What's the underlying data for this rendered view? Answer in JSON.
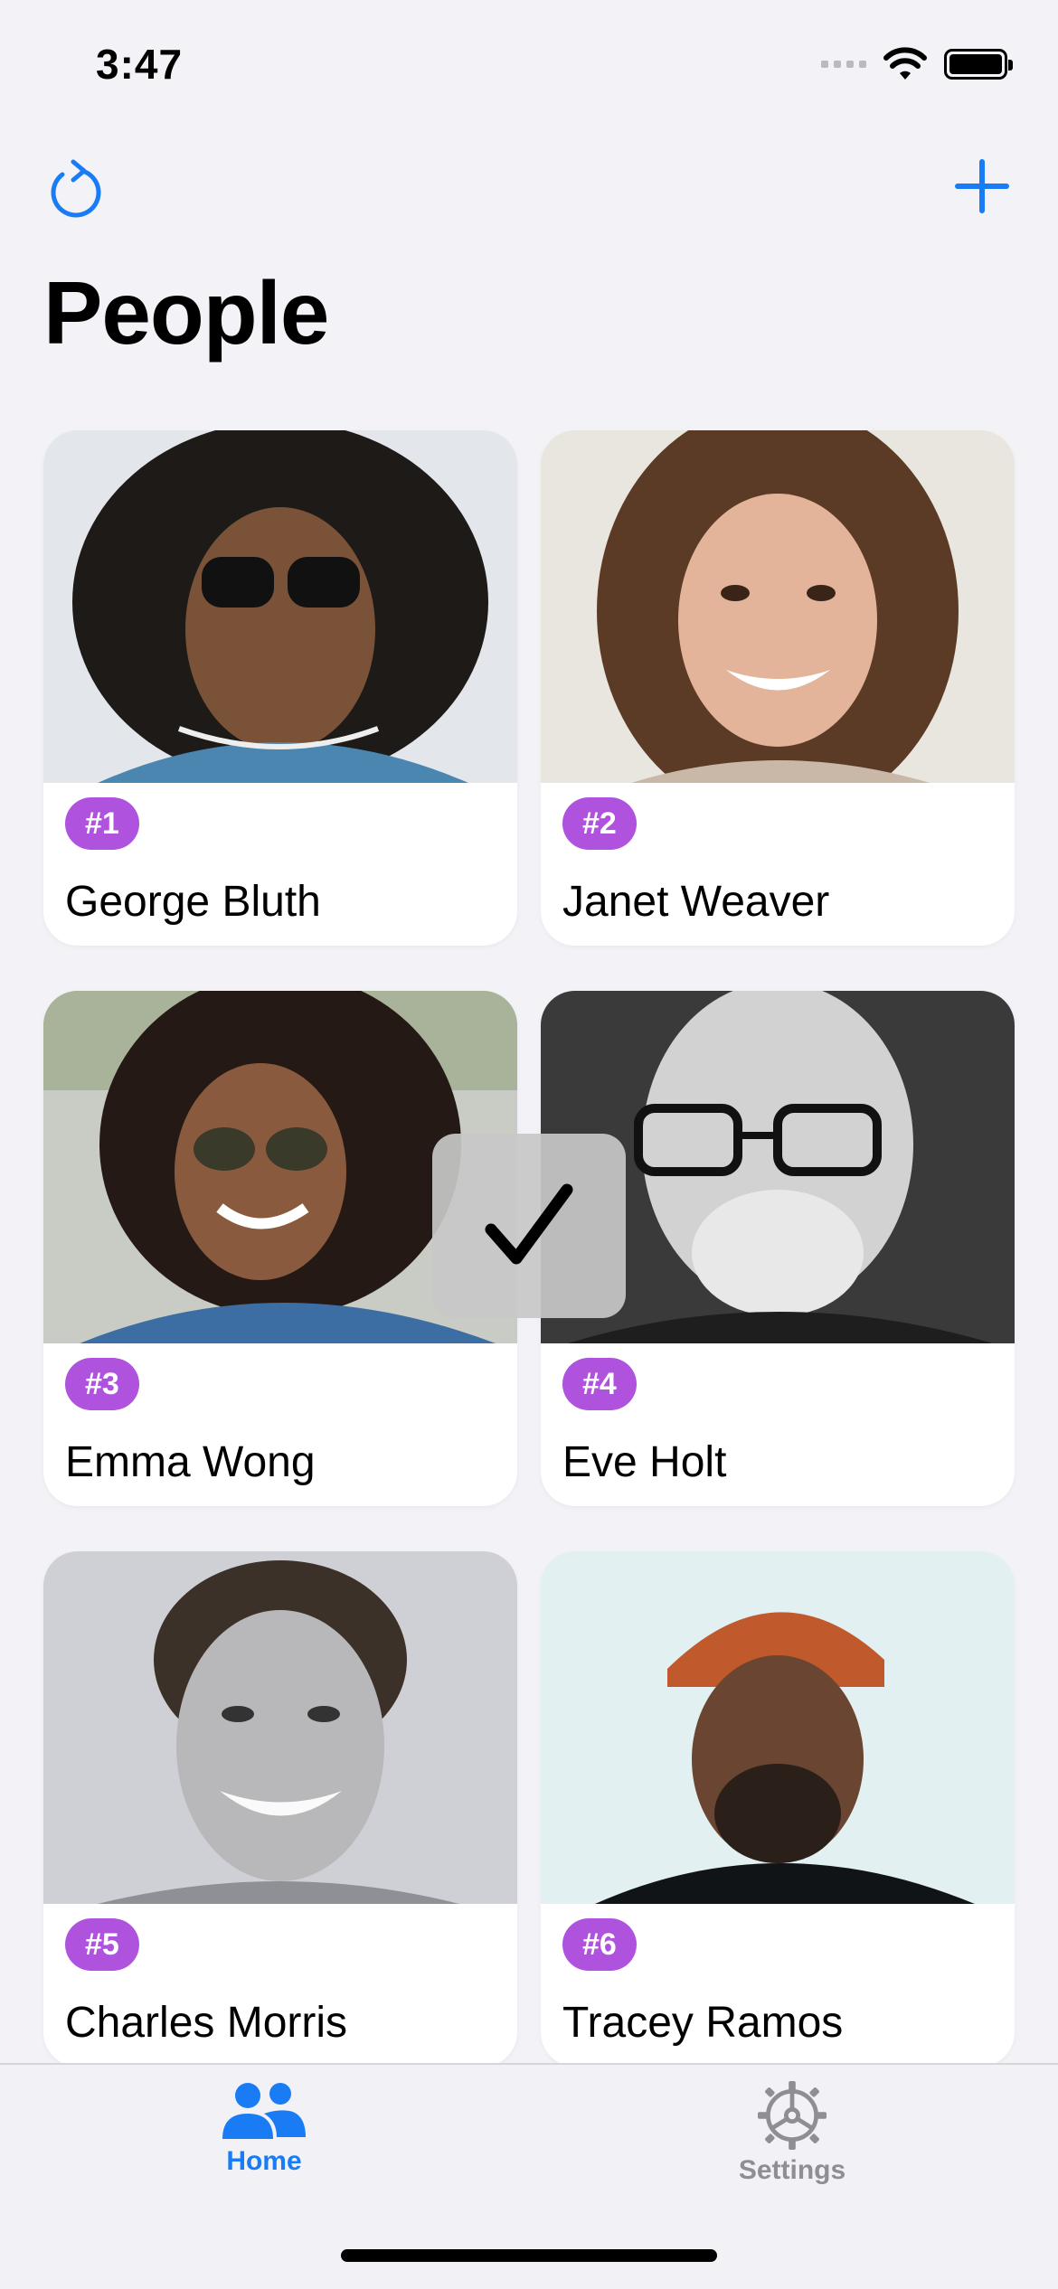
{
  "status_bar": {
    "time": "3:47"
  },
  "nav": {
    "refresh_icon": "refresh-icon",
    "add_icon": "plus-icon"
  },
  "page_title": "People",
  "people": [
    {
      "badge": "#1",
      "name": "George Bluth"
    },
    {
      "badge": "#2",
      "name": "Janet Weaver"
    },
    {
      "badge": "#3",
      "name": "Emma Wong"
    },
    {
      "badge": "#4",
      "name": "Eve Holt"
    },
    {
      "badge": "#5",
      "name": "Charles Morris"
    },
    {
      "badge": "#6",
      "name": "Tracey Ramos"
    }
  ],
  "hud": {
    "icon": "checkmark-icon"
  },
  "tab_bar": {
    "home_label": "Home",
    "settings_label": "Settings"
  },
  "colors": {
    "accent": "#1a7cf5",
    "badge": "#af52de",
    "background": "#f2f2f7"
  }
}
